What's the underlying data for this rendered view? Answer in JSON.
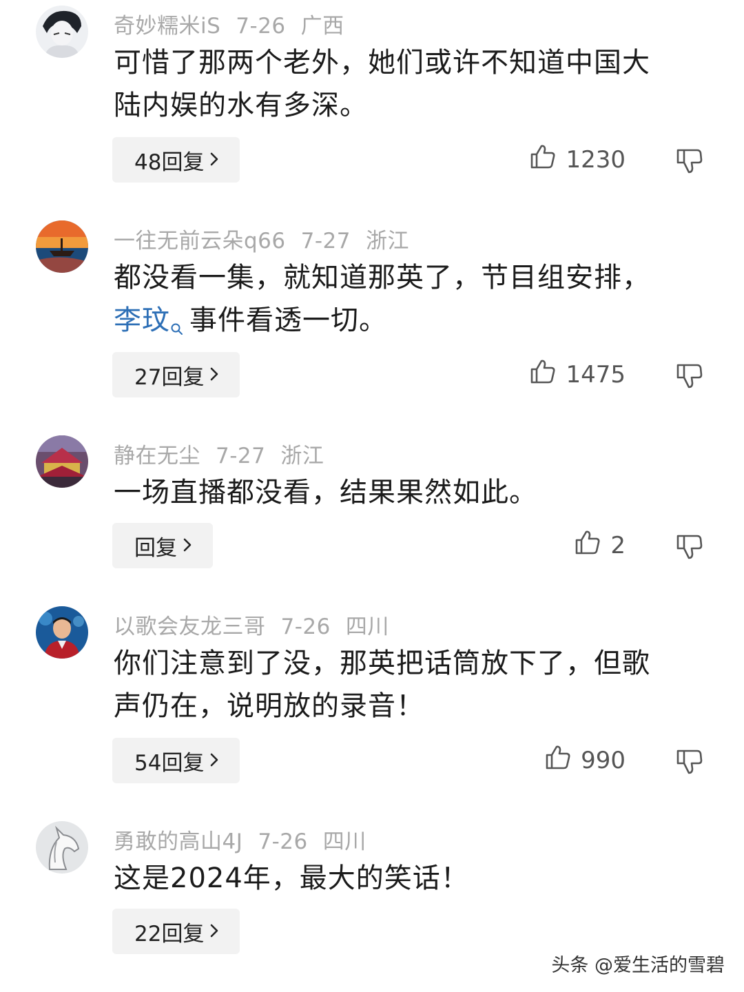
{
  "comments": [
    {
      "username": "奇妙糯米iS",
      "date": "7-26",
      "location": "广西",
      "lines": [
        "可惜了那两个老外，她们或许不知道中国大",
        "陆内娱的水有多深。"
      ],
      "reply_label": "48回复",
      "likes": "1230",
      "avatar_icon": "avatar-sketch-man"
    },
    {
      "username": "一往无前云朵q66",
      "date": "7-27",
      "location": "浙江",
      "line1": "都没看一集，就知道那英了，节目组安排，",
      "link_text": "李玟",
      "line2_rest": "事件看透一切。",
      "reply_label": "27回复",
      "likes": "1475",
      "avatar_icon": "avatar-sunset-boat"
    },
    {
      "username": "静在无尘",
      "date": "7-27",
      "location": "浙江",
      "lines": [
        "一场直播都没看，结果果然如此。"
      ],
      "reply_label": "回复",
      "likes": "2",
      "avatar_icon": "avatar-palace"
    },
    {
      "username": "以歌会友龙三哥",
      "date": "7-26",
      "location": "四川",
      "lines": [
        "你们注意到了没，那英把话筒放下了，但歌",
        "声仍在，说明放的录音！"
      ],
      "reply_label": "54回复",
      "likes": "990",
      "avatar_icon": "avatar-man-portrait"
    },
    {
      "username": "勇敢的高山4J",
      "date": "7-26",
      "location": "四川",
      "lines": [
        "这是2024年，最大的笑话！"
      ],
      "reply_label": "22回复",
      "likes": "",
      "avatar_icon": "avatar-horse-sketch"
    }
  ],
  "watermark": "头条 @爱生活的雪碧",
  "colors": {
    "meta": "#a8a8a8",
    "text": "#1b1b1b",
    "link": "#2d6fb6",
    "reply_bg": "#f2f2f2"
  },
  "icons": [
    "thumbs-up-icon",
    "thumbs-down-icon",
    "chevron-right-icon",
    "search-icon"
  ]
}
